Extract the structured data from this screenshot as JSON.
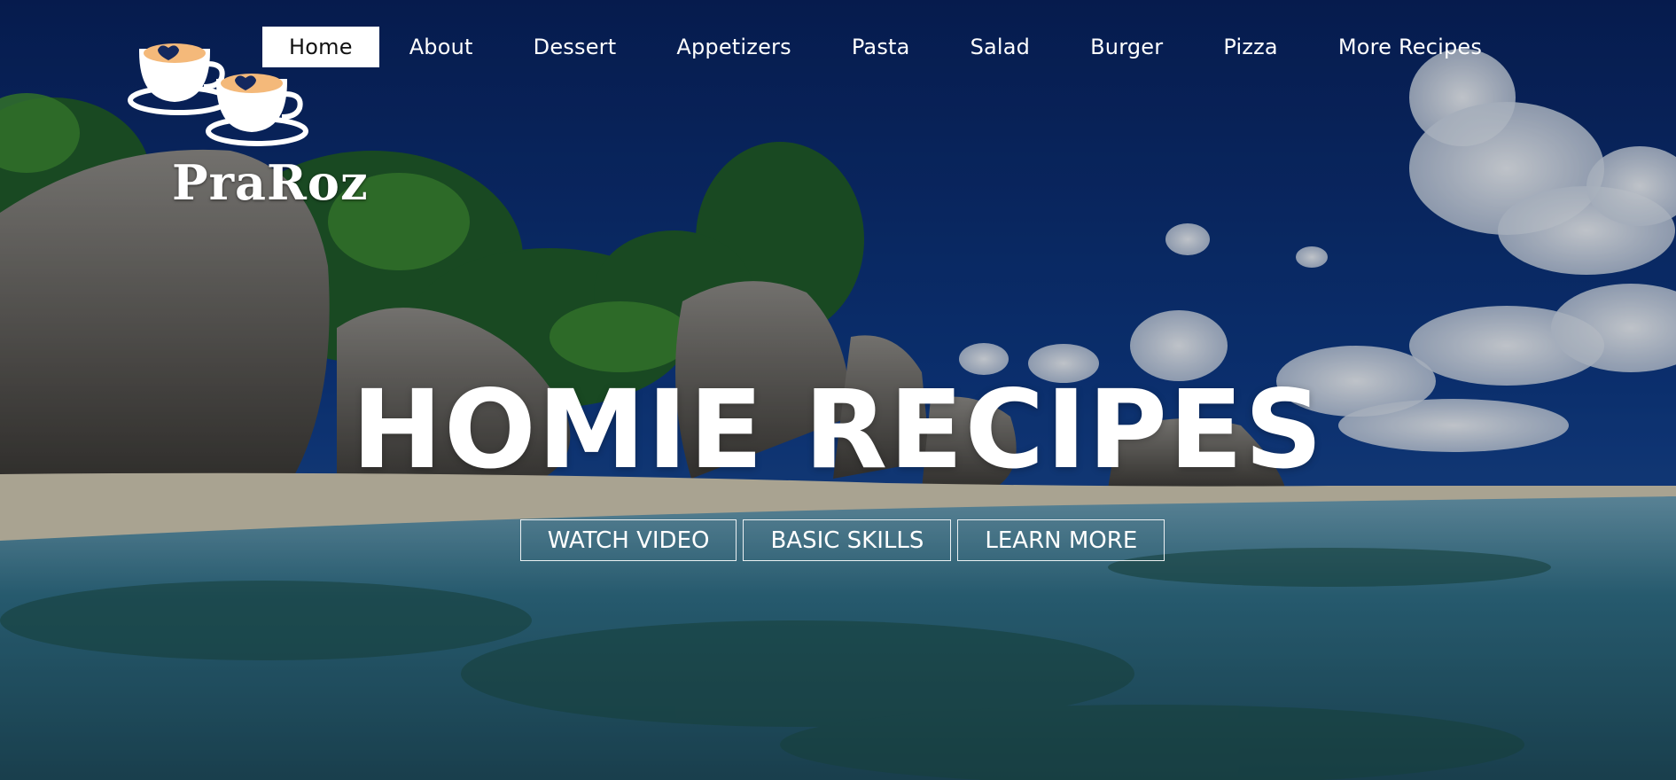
{
  "brand": {
    "name": "PraRoz"
  },
  "nav": {
    "items": [
      {
        "label": "Home",
        "active": true
      },
      {
        "label": "About"
      },
      {
        "label": "Dessert"
      },
      {
        "label": "Appetizers"
      },
      {
        "label": "Pasta"
      },
      {
        "label": "Salad"
      },
      {
        "label": "Burger"
      },
      {
        "label": "Pizza"
      },
      {
        "label": "More Recipes"
      }
    ]
  },
  "hero": {
    "title": "HOMIE RECIPES",
    "buttons": [
      {
        "label": "WATCH VIDEO"
      },
      {
        "label": "BASIC SKILLS"
      },
      {
        "label": "LEARN MORE"
      }
    ]
  },
  "colors": {
    "sky": "#0b2a6e",
    "sea": "#2c6f86",
    "sand": "#d8d2c0",
    "text": "#ffffff",
    "logo_accent": "#f4b97a"
  }
}
